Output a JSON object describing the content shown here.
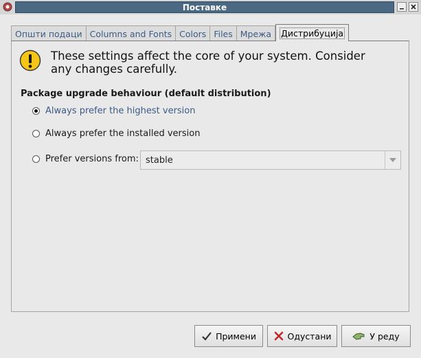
{
  "window": {
    "title": "Поставке"
  },
  "tabs": [
    {
      "label": "Општи подаци"
    },
    {
      "label": "Columns and Fonts"
    },
    {
      "label": "Colors"
    },
    {
      "label": "Files"
    },
    {
      "label": "Мрежа"
    },
    {
      "label": "Дистрибуција",
      "active": true
    }
  ],
  "warning": {
    "icon": "warning-icon",
    "text": "These settings affect the core of your system. Consider any changes carefully."
  },
  "upgrade": {
    "title": "Package upgrade behaviour (default distribution)",
    "options": [
      {
        "label": "Always prefer the highest version",
        "selected": true
      },
      {
        "label": "Always prefer the installed version",
        "selected": false
      },
      {
        "label": "Prefer versions from:",
        "selected": false
      }
    ],
    "distribution_value": "stable"
  },
  "buttons": {
    "apply": "Примени",
    "cancel": "Одустани",
    "ok": "У реду"
  },
  "colors": {
    "title_bar": "#4b6983",
    "selected_text": "#3b5b87",
    "warning_icon": "#f5c518"
  }
}
